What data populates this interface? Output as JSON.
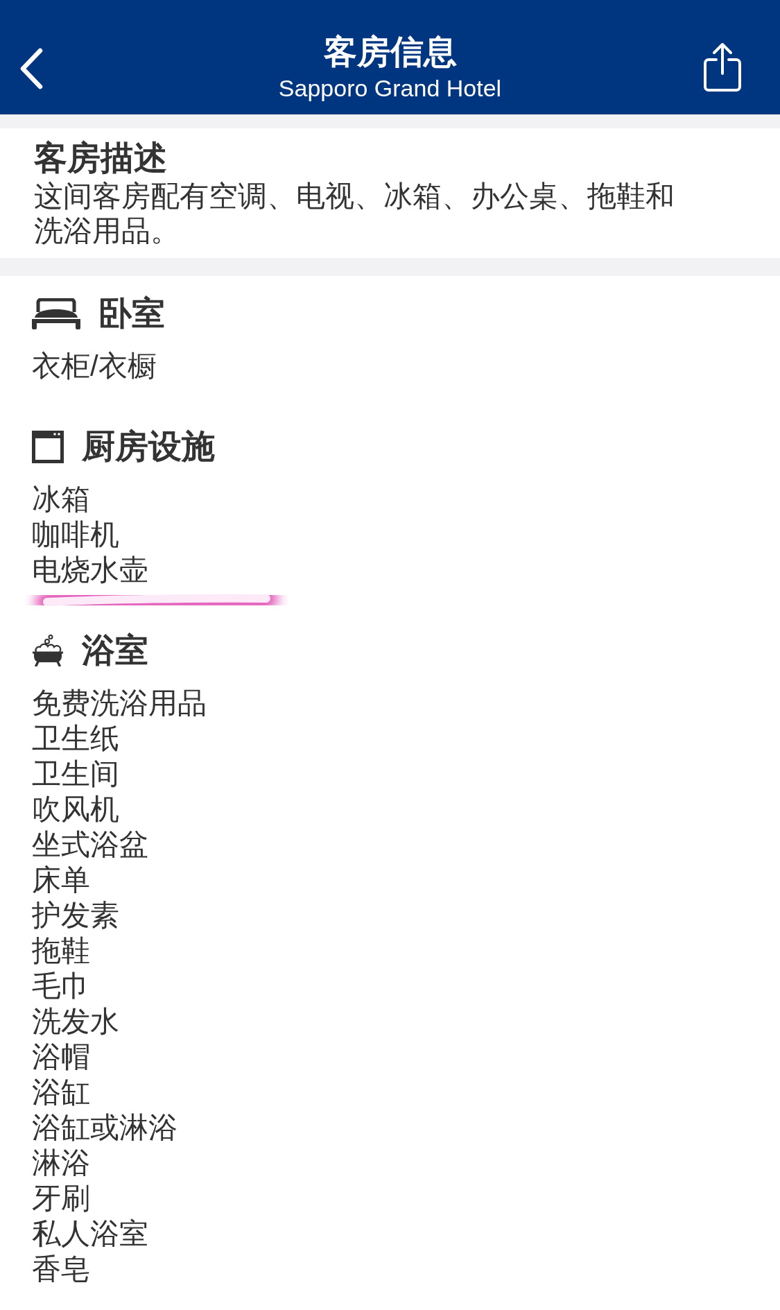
{
  "header": {
    "title": "客房信息",
    "subtitle": "Sapporo Grand Hotel"
  },
  "description": {
    "heading": "客房描述",
    "text": "这间客房配有空调、电视、冰箱、办公桌、拖鞋和洗浴用品。"
  },
  "sections": [
    {
      "kind": "bedroom",
      "title": "卧室",
      "items": [
        "衣柜/衣橱"
      ]
    },
    {
      "kind": "kitchen",
      "title": "厨房设施",
      "items": [
        "冰箱",
        "咖啡机",
        "电烧水壶"
      ]
    },
    {
      "kind": "bathroom",
      "title": "浴室",
      "items": [
        "免费洗浴用品",
        "卫生纸",
        "卫生间",
        "吹风机",
        "坐式浴盆",
        "床单",
        "护发素",
        "拖鞋",
        "毛巾",
        "洗发水",
        "浴帽",
        "浴缸",
        "浴缸或淋浴",
        "淋浴",
        "牙刷",
        "私人浴室",
        "香皂"
      ]
    }
  ]
}
